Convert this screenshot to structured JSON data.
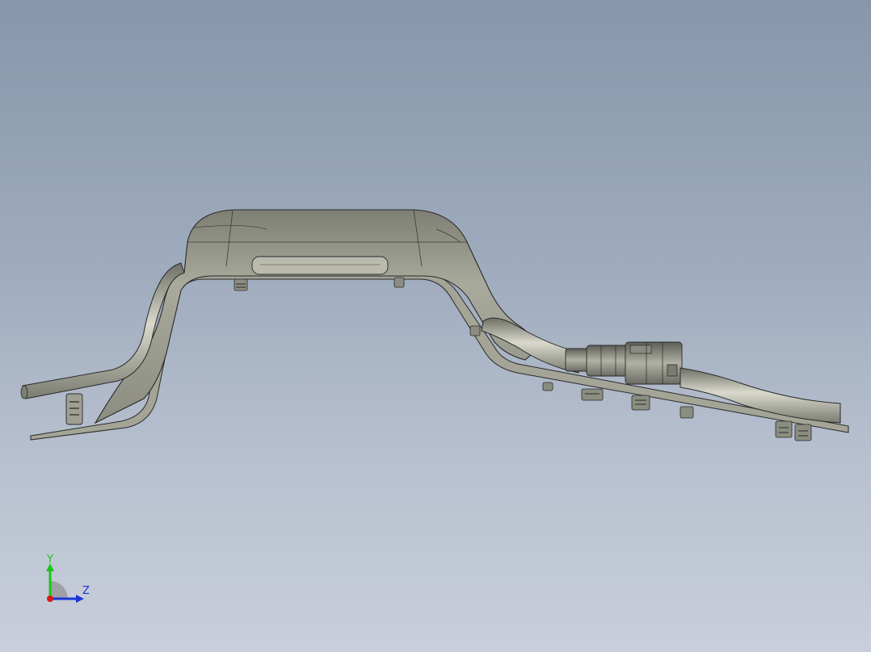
{
  "viewport": {
    "background_top": "#8796ab",
    "background_bottom": "#c9cfda"
  },
  "model": {
    "body_fill": "#9d9e90",
    "body_highlight": "#c6c6b8",
    "edge_color": "#2a2a2a"
  },
  "triad": {
    "y_label": "Y",
    "z_label": "Z",
    "y_color": "#18c818",
    "z_color": "#1a35d8",
    "x_color": "#d81818"
  }
}
